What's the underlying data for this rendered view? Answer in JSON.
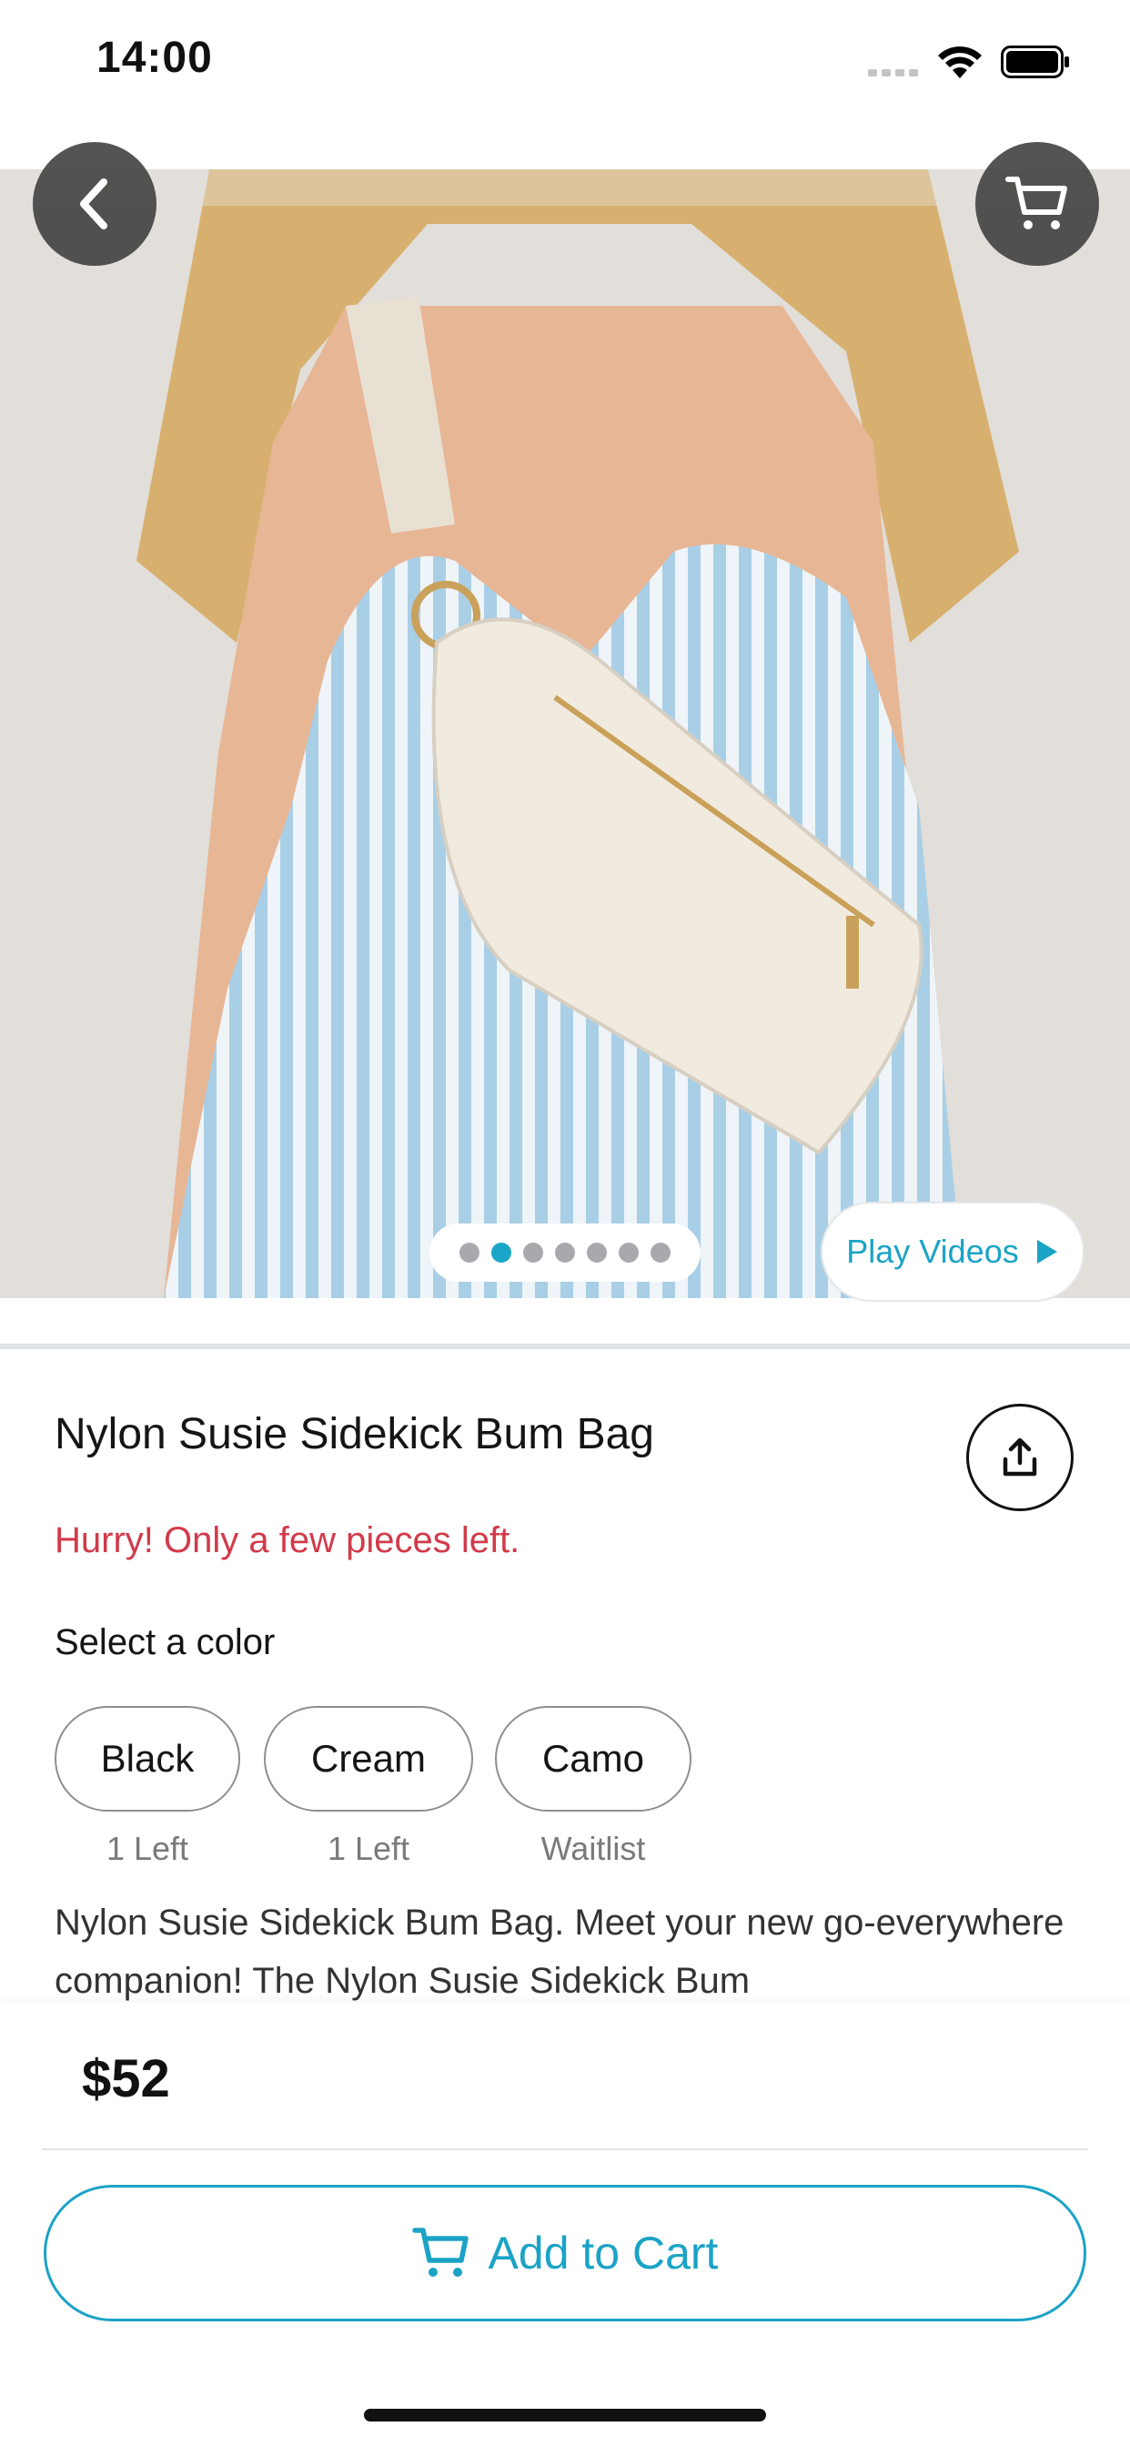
{
  "status_bar": {
    "time": "14:00"
  },
  "product": {
    "title": "Nylon Susie Sidekick Bum Bag",
    "urgency": "Hurry! Only a few pieces left.",
    "image_count": 7,
    "active_image_index": 1,
    "play_videos_label": "Play Videos",
    "description": "Nylon Susie Sidekick Bum Bag. Meet your new go-everywhere companion! The Nylon Susie Sidekick Bum",
    "price": "$52"
  },
  "colors": {
    "label": "Select a color",
    "options": [
      {
        "name": "Black",
        "stock": "1 Left"
      },
      {
        "name": "Cream",
        "stock": "1 Left"
      },
      {
        "name": "Camo",
        "stock": "Waitlist"
      }
    ]
  },
  "cart": {
    "add_label": "Add to Cart"
  },
  "icons": {
    "back": "chevron-left-icon",
    "cart": "cart-icon",
    "share": "share-icon",
    "play": "play-icon"
  },
  "theme": {
    "accent": "#1ba3c6",
    "urgency": "#d23a4a",
    "overlay": "#3c3c3c"
  }
}
